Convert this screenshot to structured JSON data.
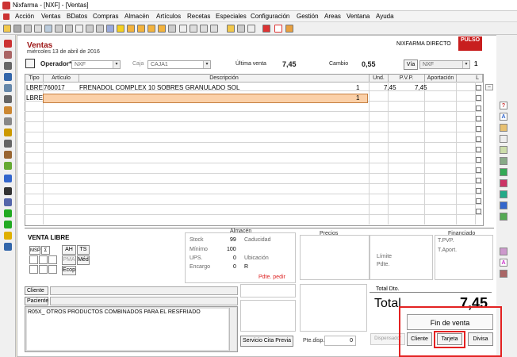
{
  "window": {
    "title": "Nixfarma - [NXF] - [Ventas]"
  },
  "menu": [
    "Acción",
    "Ventas",
    "BDatos",
    "Compras",
    "Almacén",
    "Artículos",
    "Recetas",
    "Especiales",
    "Configuración",
    "Gestión",
    "Areas",
    "Ventana",
    "Ayuda"
  ],
  "form": {
    "title": "Ventas",
    "date": "miércoles 13 de abril de 2016",
    "company": "NIXFARMA DIRECTO",
    "logo_text": "PULSO",
    "operador_label": "Operador*",
    "operador_value": "NXF",
    "caja_label": "Caja",
    "caja_value": "CAJA1",
    "ultima_venta_label": "Última venta",
    "ultima_venta_value": "7,45",
    "cambio_label": "Cambio",
    "cambio_value": "0,55",
    "via_label": "Vía",
    "via_value": "NXF",
    "via_count": "1"
  },
  "grid": {
    "headers": [
      "Tipo",
      "Artículo",
      "Descripción",
      "Und.",
      "P.V.P.",
      "Aportación",
      "L"
    ],
    "rows": [
      {
        "tipo": "LBRE",
        "articulo": "760017",
        "descripcion": "FRENADOL COMPLEX 10 SOBRES GRANULADO SOL",
        "und": "1",
        "pvp": "7,45",
        "aportacion": "7,45"
      },
      {
        "tipo": "LBRE",
        "articulo": "",
        "descripcion": "",
        "und": "1",
        "pvp": "",
        "aportacion": ""
      }
    ]
  },
  "bottom": {
    "venta_libre": "VENTA LIBRE",
    "small_labels": [
      "MSP",
      "Σ",
      "AH",
      "TS",
      "PMA",
      "Méd",
      "Ecop"
    ],
    "almacen_title": "Almacén",
    "stock_label": "Stock",
    "stock_value": "99",
    "minimo_label": "Mínimo",
    "minimo_value": "100",
    "ups_label": "UPS.",
    "ups_value": "0",
    "encargo_label": "Encargo",
    "encargo_value": "0",
    "caducidad_label": "Caducidad",
    "ubicacion_label": "Ubicación",
    "ubicacion_value": "R",
    "pdte_pedir": "Pdte. pedir",
    "precios_title": "Precios",
    "limite_label": "Límite",
    "pdte_label": "Pdte.",
    "financiado_title": "Financiado",
    "tpvp_label": "T.PVP.",
    "taport_label": "T.Aport.",
    "cliente_label": "Cliente",
    "paciente_label": "Paciente",
    "notes": "R05X_ OTROS PRODUCTOS COMBINADOS PARA EL RESFRIADO",
    "servicio_cita": "Servicio Cita Previa",
    "pte_disp_label": "Pte.disp.",
    "pte_disp_value": "0",
    "total_dto_label": "Total Dto.",
    "total_label": "Total",
    "total_value": "7,45",
    "dispensador": "Dispensador",
    "fin_venta": "Fin de venta",
    "btn_cliente": "Cliente",
    "btn_tarjeta": "Tarjeta",
    "btn_divisa": "Divisa"
  },
  "accent": {
    "brand_red": "#c81e1e",
    "title_red": "#9a1111",
    "highlight": "#e32222",
    "edit_cell": "#fbd0a8"
  }
}
